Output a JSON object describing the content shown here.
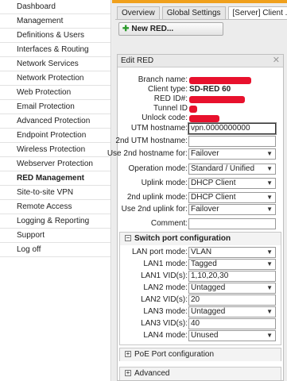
{
  "sidebar": {
    "items": [
      {
        "label": "Dashboard"
      },
      {
        "label": "Management"
      },
      {
        "label": "Definitions & Users"
      },
      {
        "label": "Interfaces & Routing"
      },
      {
        "label": "Network Services"
      },
      {
        "label": "Network Protection"
      },
      {
        "label": "Web Protection"
      },
      {
        "label": "Email Protection"
      },
      {
        "label": "Advanced Protection"
      },
      {
        "label": "Endpoint Protection"
      },
      {
        "label": "Wireless Protection"
      },
      {
        "label": "Webserver Protection"
      },
      {
        "label": "RED Management",
        "active": true
      },
      {
        "label": "Site-to-site VPN"
      },
      {
        "label": "Remote Access"
      },
      {
        "label": "Logging & Reporting"
      },
      {
        "label": "Support"
      },
      {
        "label": "Log off"
      }
    ]
  },
  "tabs": [
    {
      "label": "Overview"
    },
    {
      "label": "Global Settings"
    },
    {
      "label": "[Server] Client ..."
    }
  ],
  "new_button": {
    "label": "New RED..."
  },
  "dialog": {
    "title": "Edit RED",
    "close_icon": "close-icon",
    "branch_name_label": "Branch name:",
    "client_type_label": "Client type:",
    "client_type_value": "SD-RED 60",
    "red_id_label": "RED ID#:",
    "tunnel_id_label": "Tunnel ID",
    "unlock_code_label": "Unlock code:",
    "utm_hostname_label": "UTM hostname:",
    "utm_hostname_value": "vpn.0000000000",
    "utm_hostname2_label": "2nd UTM hostname:",
    "utm_hostname2_value": "",
    "use2nd_label": "Use 2nd hostname for:",
    "use2nd_value": "Failover",
    "operation_mode_label": "Operation mode:",
    "operation_mode_value": "Standard / Unified",
    "uplink_mode_label": "Uplink mode:",
    "uplink_mode_value": "DHCP Client",
    "uplink2_mode_label": "2nd uplink mode:",
    "uplink2_mode_value": "DHCP Client",
    "use2nd_uplink_label": "Use 2nd uplink for:",
    "use2nd_uplink_value": "Failover",
    "comment_label": "Comment:",
    "comment_value": ""
  },
  "switch_section": {
    "title": "Switch port configuration",
    "toggle": "−",
    "lan_port_mode_label": "LAN port mode:",
    "lan_port_mode_value": "VLAN",
    "lan1_mode_label": "LAN1 mode:",
    "lan1_mode_value": "Tagged",
    "lan1_vids_label": "LAN1 VID(s):",
    "lan1_vids_value": "1,10,20,30",
    "lan2_mode_label": "LAN2 mode:",
    "lan2_mode_value": "Untagged",
    "lan2_vids_label": "LAN2 VID(s):",
    "lan2_vids_value": "20",
    "lan3_mode_label": "LAN3 mode:",
    "lan3_mode_value": "Untagged",
    "lan3_vids_label": "LAN3 VID(s):",
    "lan3_vids_value": "40",
    "lan4_mode_label": "LAN4 mode:",
    "lan4_mode_value": "Unused"
  },
  "poe_section": {
    "title": "PoE Port configuration",
    "toggle": "+"
  },
  "advanced_section": {
    "title": "Advanced",
    "toggle": "+"
  },
  "colors": {
    "accent": "#f0a01c",
    "redaction": "#e8112d"
  }
}
